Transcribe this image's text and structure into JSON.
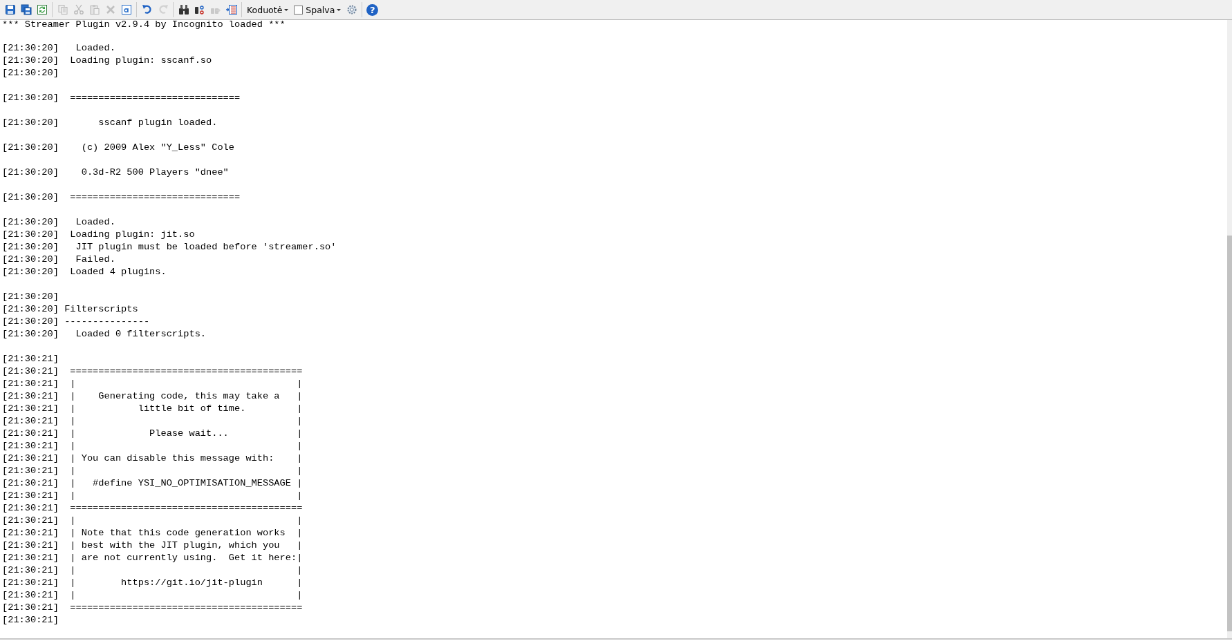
{
  "toolbar": {
    "items": [
      {
        "kind": "icon",
        "disabled": false
      },
      {
        "kind": "icon",
        "disabled": false
      },
      {
        "kind": "icon",
        "disabled": false
      },
      {
        "kind": "separator"
      },
      {
        "kind": "icon",
        "disabled": true
      },
      {
        "kind": "icon",
        "disabled": true
      },
      {
        "kind": "icon",
        "disabled": true
      },
      {
        "kind": "icon",
        "disabled": true
      },
      {
        "kind": "icon",
        "disabled": false
      },
      {
        "kind": "separator"
      },
      {
        "kind": "icon",
        "disabled": false
      },
      {
        "kind": "icon",
        "disabled": true
      },
      {
        "kind": "separator"
      },
      {
        "kind": "icon",
        "disabled": false
      },
      {
        "kind": "icon",
        "disabled": false
      },
      {
        "kind": "icon",
        "disabled": true
      },
      {
        "kind": "icon",
        "disabled": false
      },
      {
        "kind": "separator"
      },
      {
        "kind": "menu",
        "label": "Koduotė"
      },
      {
        "kind": "check",
        "label": "Spalva",
        "checked": false
      },
      {
        "kind": "icon",
        "disabled": false
      },
      {
        "kind": "separator"
      },
      {
        "kind": "help",
        "label": "?"
      }
    ]
  },
  "log": {
    "lines": [
      {
        "kind": "header",
        "text": "*** Streamer Plugin v2.9.4 by Incognito loaded ***"
      },
      {
        "kind": "blank"
      },
      {
        "kind": "entry",
        "time": "[21:30:20]",
        "text": "   Loaded."
      },
      {
        "kind": "entry",
        "time": "[21:30:20]",
        "text": "  Loading plugin: sscanf.so"
      },
      {
        "kind": "entry",
        "time": "[21:30:20]"
      },
      {
        "kind": "blank"
      },
      {
        "kind": "entry",
        "time": "[21:30:20]",
        "text": "  =============================="
      },
      {
        "kind": "blank"
      },
      {
        "kind": "entry",
        "time": "[21:30:20]",
        "text": "       sscanf plugin loaded."
      },
      {
        "kind": "blank"
      },
      {
        "kind": "entry",
        "time": "[21:30:20]",
        "text": "    (c) 2009 Alex \"Y_Less\" Cole"
      },
      {
        "kind": "blank"
      },
      {
        "kind": "entry",
        "time": "[21:30:20]",
        "text": "    0.3d-R2 500 Players \"dnee\""
      },
      {
        "kind": "blank"
      },
      {
        "kind": "entry",
        "time": "[21:30:20]",
        "text": "  =============================="
      },
      {
        "kind": "blank"
      },
      {
        "kind": "entry",
        "time": "[21:30:20]",
        "text": "   Loaded."
      },
      {
        "kind": "entry",
        "time": "[21:30:20]",
        "text": "  Loading plugin: jit.so"
      },
      {
        "kind": "entry",
        "time": "[21:30:20]",
        "text": "   JIT plugin must be loaded before 'streamer.so'"
      },
      {
        "kind": "entry",
        "time": "[21:30:20]",
        "text": "   Failed."
      },
      {
        "kind": "entry",
        "time": "[21:30:20]",
        "text": "  Loaded 4 plugins."
      },
      {
        "kind": "blank"
      },
      {
        "kind": "entry",
        "time": "[21:30:20]"
      },
      {
        "kind": "entry",
        "time": "[21:30:20]",
        "text": " Filterscripts"
      },
      {
        "kind": "entry",
        "time": "[21:30:20]",
        "text": " ---------------"
      },
      {
        "kind": "entry",
        "time": "[21:30:20]",
        "text": "   Loaded 0 filterscripts."
      },
      {
        "kind": "blank"
      },
      {
        "kind": "entry",
        "time": "[21:30:21]"
      },
      {
        "kind": "entry",
        "time": "[21:30:21]",
        "text": "  ========================================="
      },
      {
        "kind": "entry",
        "time": "[21:30:21]",
        "text": "  |                                       |"
      },
      {
        "kind": "entry",
        "time": "[21:30:21]",
        "text": "  |    Generating code, this may take a   |"
      },
      {
        "kind": "entry",
        "time": "[21:30:21]",
        "text": "  |           little bit of time.         |"
      },
      {
        "kind": "entry",
        "time": "[21:30:21]",
        "text": "  |                                       |"
      },
      {
        "kind": "entry",
        "time": "[21:30:21]",
        "text": "  |             Please wait...            |"
      },
      {
        "kind": "entry",
        "time": "[21:30:21]",
        "text": "  |                                       |"
      },
      {
        "kind": "entry",
        "time": "[21:30:21]",
        "text": "  | You can disable this message with:    |"
      },
      {
        "kind": "entry",
        "time": "[21:30:21]",
        "text": "  |                                       |"
      },
      {
        "kind": "entry",
        "time": "[21:30:21]",
        "text": "  |   #define YSI_NO_OPTIMISATION_MESSAGE |"
      },
      {
        "kind": "entry",
        "time": "[21:30:21]",
        "text": "  |                                       |"
      },
      {
        "kind": "entry",
        "time": "[21:30:21]",
        "text": "  ========================================="
      },
      {
        "kind": "entry",
        "time": "[21:30:21]",
        "text": "  |                                       |"
      },
      {
        "kind": "entry",
        "time": "[21:30:21]",
        "text": "  | Note that this code generation works  |"
      },
      {
        "kind": "entry",
        "time": "[21:30:21]",
        "text": "  | best with the JIT plugin, which you   |"
      },
      {
        "kind": "entry",
        "time": "[21:30:21]",
        "text": "  | are not currently using.  Get it here:|"
      },
      {
        "kind": "entry",
        "time": "[21:30:21]",
        "text": "  |                                       |"
      },
      {
        "kind": "entry",
        "time": "[21:30:21]",
        "text": "  |        https://git.io/jit-plugin      |"
      },
      {
        "kind": "entry",
        "time": "[21:30:21]",
        "text": "  |                                       |"
      },
      {
        "kind": "entry",
        "time": "[21:30:21]",
        "text": "  ========================================="
      },
      {
        "kind": "entry",
        "time": "[21:30:21]"
      }
    ]
  }
}
